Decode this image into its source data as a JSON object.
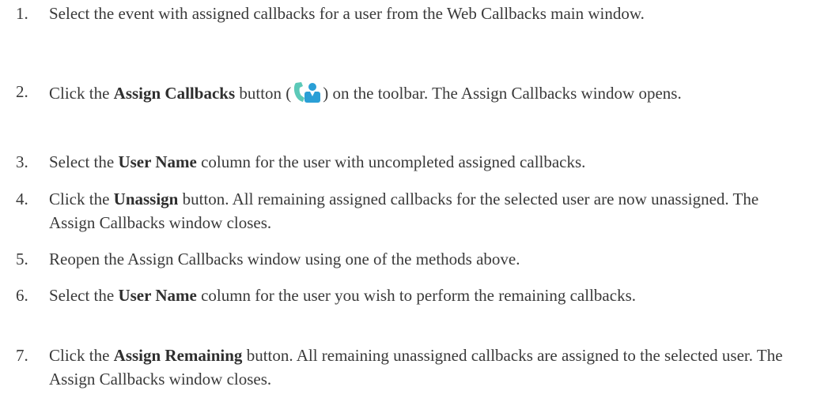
{
  "steps": [
    {
      "num": "1.",
      "parts": {
        "a": "Select the event with assigned callbacks for a user from the Web Callbacks main window."
      }
    },
    {
      "num": "2.",
      "parts": {
        "a": "Click the ",
        "b": "Assign Callbacks",
        "c": " button (",
        "icon": "assign-callbacks-icon",
        "d": ") on the toolbar. The Assign Callbacks window opens."
      }
    },
    {
      "num": "3.",
      "parts": {
        "a": "Select the ",
        "b": "User Name",
        "c": " column for the user with uncompleted assigned callbacks."
      }
    },
    {
      "num": "4.",
      "parts": {
        "a": "Click the ",
        "b": "Unassign",
        "c": " button. All remaining assigned callbacks for the selected user are now unassigned. The Assign Callbacks window closes."
      }
    },
    {
      "num": "5.",
      "parts": {
        "a": "Reopen the Assign Callbacks window using one of the methods above."
      }
    },
    {
      "num": "6.",
      "parts": {
        "a": "Select the ",
        "b": "User Name",
        "c": " column for the user you wish to perform the remaining callbacks."
      }
    },
    {
      "num": "7.",
      "parts": {
        "a": "Click the ",
        "b": "Assign Remaining",
        "c": " button. All remaining unassigned callbacks are assigned to the selected user. The Assign Callbacks window closes."
      }
    }
  ],
  "colors": {
    "text": "#3a3a3a",
    "icon_phone": "#5cc9b8",
    "icon_person": "#2a9fd6"
  }
}
